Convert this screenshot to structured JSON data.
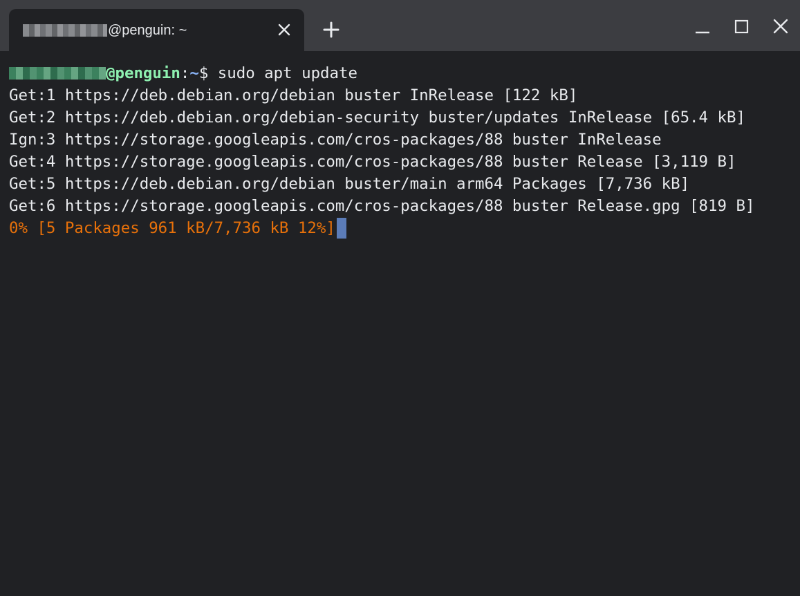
{
  "tab": {
    "title": "@penguin: ~"
  },
  "terminal": {
    "prompt": {
      "host": "@penguin",
      "separator": ":",
      "path": "~",
      "symbol": "$",
      "command": " sudo apt update"
    },
    "lines": [
      "Get:1 https://deb.debian.org/debian buster InRelease [122 kB]",
      "Get:2 https://deb.debian.org/debian-security buster/updates InRelease [65.4 kB]",
      "Ign:3 https://storage.googleapis.com/cros-packages/88 buster InRelease",
      "Get:4 https://storage.googleapis.com/cros-packages/88 buster Release [3,119 B]",
      "Get:5 https://deb.debian.org/debian buster/main arm64 Packages [7,736 kB]",
      "Get:6 https://storage.googleapis.com/cros-packages/88 buster Release.gpg [819 B]"
    ],
    "progress": "0% [5 Packages 961 kB/7,736 kB 12%]"
  },
  "icons": {
    "tab_close": "close-icon",
    "new_tab": "plus-icon",
    "minimize": "minimize-icon",
    "maximize": "maximize-icon",
    "close": "close-icon"
  },
  "colors": {
    "background": "#202124",
    "titlebar": "#3c3d41",
    "prompt_host": "#8ef0b0",
    "prompt_path": "#8ab4f8",
    "progress": "#e8710a",
    "cursor": "#5b7cb8"
  }
}
